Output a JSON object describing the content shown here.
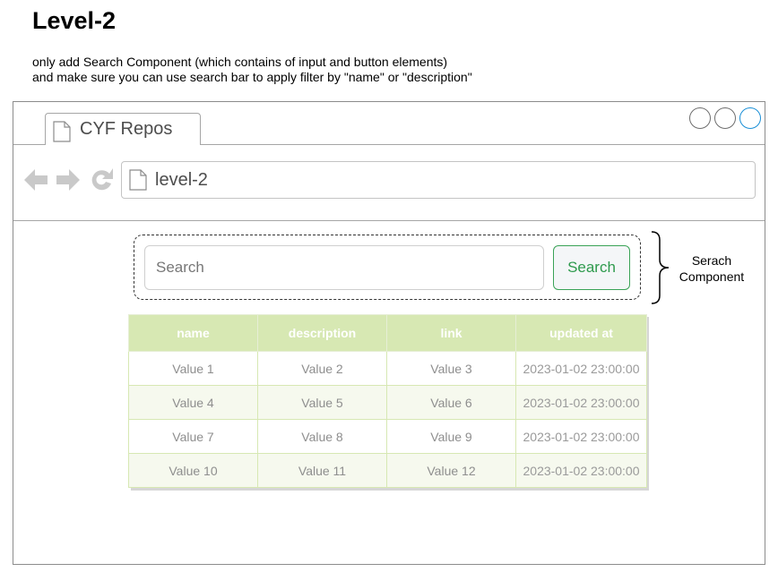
{
  "page": {
    "title": "Level-2",
    "instructions": [
      "only add Search Component (which contains of input and button elements)",
      "and make sure you can use search bar to apply filter by \"name\" or \"description\""
    ]
  },
  "browser": {
    "tab_label": "CYF Repos",
    "address": "level-2",
    "icons": [
      "doc-icon",
      "back-arrow-icon",
      "forward-arrow-icon",
      "reload-icon"
    ]
  },
  "search": {
    "placeholder": "Search",
    "button_label": "Search",
    "annotation": [
      "Serach",
      "Component"
    ]
  },
  "table": {
    "headers": [
      "name",
      "description",
      "link",
      "updated at"
    ],
    "rows": [
      [
        "Value 1",
        "Value 2",
        "Value 3",
        "2023-01-02 23:00:00"
      ],
      [
        "Value 4",
        "Value 5",
        "Value 6",
        "2023-01-02 23:00:00"
      ],
      [
        "Value 7",
        "Value 8",
        "Value 9",
        "2023-01-02 23:00:00"
      ],
      [
        "Value 10",
        "Value 11",
        "Value 12",
        "2023-01-02 23:00:00"
      ]
    ]
  },
  "colors": {
    "header_bg": "#d7e8b3",
    "accent_green": "#2e9a4d",
    "active_window_button": "#1a8fd6"
  }
}
